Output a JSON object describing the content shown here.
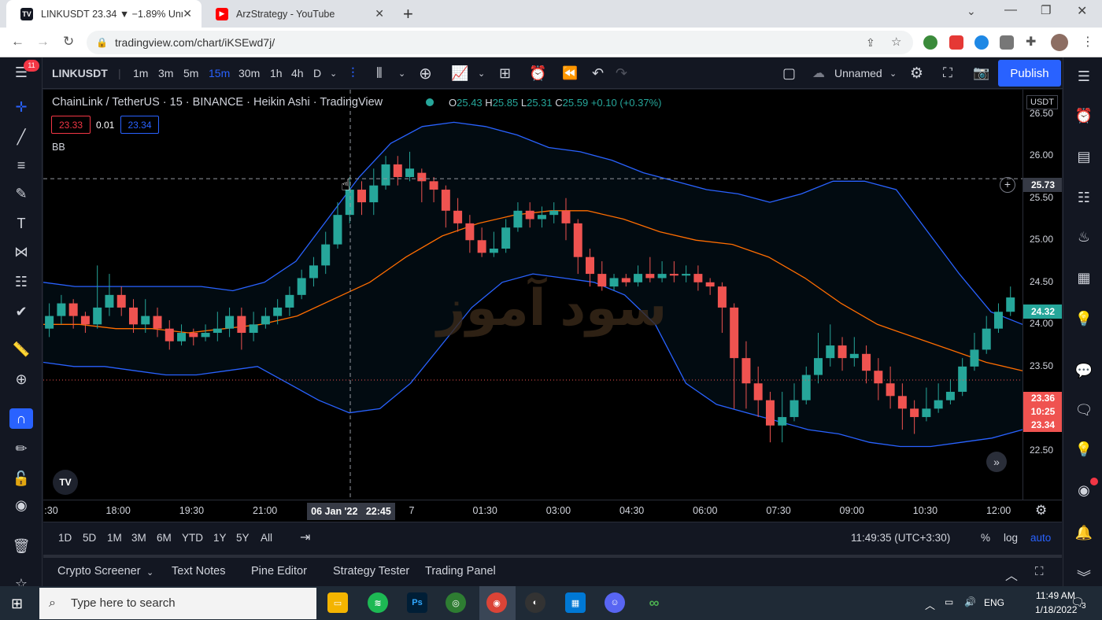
{
  "browser": {
    "tabs": [
      {
        "title": "LINKUSDT 23.34 ▼ −1.89% Unna",
        "icon": "tradingview-icon"
      },
      {
        "title": "ArzStrategy - YouTube",
        "icon": "youtube-icon"
      }
    ],
    "url": "tradingview.com/chart/iKSEwd7j/",
    "new_tab": "+"
  },
  "toolbar": {
    "symbol": "LINKUSDT",
    "intervals": [
      "1m",
      "3m",
      "5m",
      "15m",
      "30m",
      "1h",
      "4h",
      "D"
    ],
    "active_interval": "15m",
    "layout_name": "Unnamed",
    "publish": "Publish",
    "notification_count": "11"
  },
  "legend": {
    "title": "ChainLink / TetherUS · 15 · BINANCE · Heikin Ashi · TradingView",
    "o_label": "O",
    "o": "25.43",
    "h_label": "H",
    "h": "25.85",
    "l_label": "L",
    "l": "25.31",
    "c_label": "C",
    "c": "25.59",
    "change": "+0.10 (+0.37%)",
    "sell_price": "23.33",
    "spread": "0.01",
    "buy_price": "23.34",
    "indicator": "BB"
  },
  "watermark": "سود آموز",
  "price_axis": {
    "currency": "USDT",
    "ticks": [
      "26.50",
      "26.00",
      "25.50",
      "25.00",
      "24.50",
      "24.00",
      "23.50",
      "23.00",
      "22.50"
    ],
    "crosshair_price": "25.73",
    "bb_label": "24.32",
    "last_price_top": "23.36",
    "countdown": "10:25",
    "last_price": "23.34"
  },
  "time_axis": {
    "labels": [
      ":30",
      "18:00",
      "19:30",
      "21:00",
      "7",
      "01:30",
      "03:00",
      "04:30",
      "06:00",
      "07:30",
      "09:00",
      "10:30",
      "12:00"
    ],
    "crosshair_time": "06 Jan '22   22:45"
  },
  "range_bar": {
    "ranges": [
      "1D",
      "5D",
      "1M",
      "3M",
      "6M",
      "YTD",
      "1Y",
      "5Y",
      "All"
    ],
    "clock": "11:49:35 (UTC+3:30)",
    "percent": "%",
    "log": "log",
    "auto": "auto"
  },
  "bottom_tabs": [
    "Crypto Screener",
    "Text Notes",
    "Pine Editor",
    "Strategy Tester",
    "Trading Panel"
  ],
  "taskbar": {
    "search_placeholder": "Type here to search",
    "lang": "ENG",
    "time": "11:49 AM",
    "date": "1/18/2022",
    "notif": "3"
  },
  "colors": {
    "up": "#26a69a",
    "down": "#ef5350",
    "bb_band": "#2962ff",
    "bb_basis": "#ff6d00",
    "accent": "#2962ff"
  },
  "chart_data": {
    "type": "candlestick",
    "symbol": "LINKUSDT",
    "style": "Heikin Ashi",
    "interval": "15",
    "ylim": [
      22.2,
      26.6
    ],
    "candles": [
      {
        "o": 23.95,
        "c": 24.1,
        "h": 24.25,
        "l": 23.85
      },
      {
        "o": 24.1,
        "c": 24.25,
        "h": 24.35,
        "l": 24.0
      },
      {
        "o": 24.25,
        "c": 24.1,
        "h": 24.3,
        "l": 23.95
      },
      {
        "o": 24.1,
        "c": 24.0,
        "h": 24.15,
        "l": 23.9
      },
      {
        "o": 24.0,
        "c": 24.2,
        "h": 24.7,
        "l": 23.95
      },
      {
        "o": 24.2,
        "c": 24.35,
        "h": 24.6,
        "l": 24.1
      },
      {
        "o": 24.35,
        "c": 24.2,
        "h": 24.45,
        "l": 24.1
      },
      {
        "o": 24.2,
        "c": 24.0,
        "h": 24.3,
        "l": 23.9
      },
      {
        "o": 24.0,
        "c": 24.1,
        "h": 24.3,
        "l": 23.9
      },
      {
        "o": 24.1,
        "c": 23.95,
        "h": 24.2,
        "l": 23.85
      },
      {
        "o": 23.95,
        "c": 23.8,
        "h": 24.05,
        "l": 23.7
      },
      {
        "o": 23.8,
        "c": 23.9,
        "h": 24.0,
        "l": 23.75
      },
      {
        "o": 23.9,
        "c": 23.85,
        "h": 23.95,
        "l": 23.75
      },
      {
        "o": 23.85,
        "c": 23.9,
        "h": 24.0,
        "l": 23.8
      },
      {
        "o": 23.9,
        "c": 23.95,
        "h": 24.15,
        "l": 23.8
      },
      {
        "o": 23.95,
        "c": 24.1,
        "h": 24.2,
        "l": 23.85
      },
      {
        "o": 24.1,
        "c": 23.9,
        "h": 24.2,
        "l": 23.7
      },
      {
        "o": 23.9,
        "c": 24.0,
        "h": 24.15,
        "l": 23.8
      },
      {
        "o": 24.0,
        "c": 24.1,
        "h": 24.2,
        "l": 23.95
      },
      {
        "o": 24.1,
        "c": 24.2,
        "h": 24.3,
        "l": 24.0
      },
      {
        "o": 24.2,
        "c": 24.35,
        "h": 24.45,
        "l": 24.1
      },
      {
        "o": 24.35,
        "c": 24.55,
        "h": 24.65,
        "l": 24.3
      },
      {
        "o": 24.55,
        "c": 24.7,
        "h": 24.8,
        "l": 24.45
      },
      {
        "o": 24.7,
        "c": 24.95,
        "h": 25.1,
        "l": 24.6
      },
      {
        "o": 24.95,
        "c": 25.3,
        "h": 25.45,
        "l": 24.9
      },
      {
        "o": 25.3,
        "c": 25.6,
        "h": 25.75,
        "l": 25.2
      },
      {
        "o": 25.6,
        "c": 25.45,
        "h": 25.7,
        "l": 25.3
      },
      {
        "o": 25.45,
        "c": 25.65,
        "h": 25.85,
        "l": 25.3
      },
      {
        "o": 25.65,
        "c": 25.9,
        "h": 26.0,
        "l": 25.6
      },
      {
        "o": 25.9,
        "c": 25.75,
        "h": 26.0,
        "l": 25.65
      },
      {
        "o": 25.75,
        "c": 25.85,
        "h": 26.05,
        "l": 25.7
      },
      {
        "o": 25.8,
        "c": 25.7,
        "h": 25.85,
        "l": 25.45
      },
      {
        "o": 25.7,
        "c": 25.6,
        "h": 25.75,
        "l": 25.45
      },
      {
        "o": 25.6,
        "c": 25.35,
        "h": 25.65,
        "l": 25.15
      },
      {
        "o": 25.35,
        "c": 25.2,
        "h": 25.5,
        "l": 25.1
      },
      {
        "o": 25.2,
        "c": 25.0,
        "h": 25.3,
        "l": 24.85
      },
      {
        "o": 25.0,
        "c": 24.85,
        "h": 25.15,
        "l": 24.8
      },
      {
        "o": 24.85,
        "c": 24.9,
        "h": 25.1,
        "l": 24.8
      },
      {
        "o": 24.9,
        "c": 25.15,
        "h": 25.25,
        "l": 24.85
      },
      {
        "o": 25.15,
        "c": 25.35,
        "h": 25.45,
        "l": 25.1
      },
      {
        "o": 25.35,
        "c": 25.25,
        "h": 25.45,
        "l": 25.15
      },
      {
        "o": 25.25,
        "c": 25.3,
        "h": 25.4,
        "l": 25.15
      },
      {
        "o": 25.3,
        "c": 25.35,
        "h": 25.45,
        "l": 25.2
      },
      {
        "o": 25.35,
        "c": 25.2,
        "h": 25.5,
        "l": 25.0
      },
      {
        "o": 25.2,
        "c": 24.8,
        "h": 25.25,
        "l": 24.6
      },
      {
        "o": 24.8,
        "c": 24.6,
        "h": 24.9,
        "l": 24.45
      },
      {
        "o": 24.6,
        "c": 24.45,
        "h": 24.75,
        "l": 24.4
      },
      {
        "o": 24.45,
        "c": 24.55,
        "h": 24.6,
        "l": 24.4
      },
      {
        "o": 24.55,
        "c": 24.5,
        "h": 24.6,
        "l": 24.45
      },
      {
        "o": 24.5,
        "c": 24.6,
        "h": 24.7,
        "l": 24.45
      },
      {
        "o": 24.6,
        "c": 24.55,
        "h": 24.8,
        "l": 24.5
      },
      {
        "o": 24.55,
        "c": 24.6,
        "h": 24.75,
        "l": 24.5
      },
      {
        "o": 24.6,
        "c": 24.58,
        "h": 24.75,
        "l": 24.5
      },
      {
        "o": 24.58,
        "c": 24.6,
        "h": 24.7,
        "l": 24.5
      },
      {
        "o": 24.6,
        "c": 24.5,
        "h": 24.7,
        "l": 24.4
      },
      {
        "o": 24.5,
        "c": 24.45,
        "h": 24.55,
        "l": 24.35
      },
      {
        "o": 24.45,
        "c": 24.2,
        "h": 24.5,
        "l": 23.9
      },
      {
        "o": 24.2,
        "c": 23.6,
        "h": 24.25,
        "l": 23.0
      },
      {
        "o": 23.6,
        "c": 23.3,
        "h": 23.8,
        "l": 23.0
      },
      {
        "o": 23.3,
        "c": 23.1,
        "h": 23.5,
        "l": 22.9
      },
      {
        "o": 23.1,
        "c": 22.8,
        "h": 23.2,
        "l": 22.6
      },
      {
        "o": 22.8,
        "c": 22.9,
        "h": 23.2,
        "l": 22.6
      },
      {
        "o": 22.9,
        "c": 23.1,
        "h": 23.3,
        "l": 22.85
      },
      {
        "o": 23.1,
        "c": 23.4,
        "h": 23.5,
        "l": 23.05
      },
      {
        "o": 23.4,
        "c": 23.6,
        "h": 23.9,
        "l": 23.3
      },
      {
        "o": 23.6,
        "c": 23.75,
        "h": 24.0,
        "l": 23.5
      },
      {
        "o": 23.75,
        "c": 23.6,
        "h": 23.85,
        "l": 23.45
      },
      {
        "o": 23.6,
        "c": 23.65,
        "h": 23.85,
        "l": 23.5
      },
      {
        "o": 23.65,
        "c": 23.45,
        "h": 23.75,
        "l": 23.3
      },
      {
        "o": 23.45,
        "c": 23.3,
        "h": 23.6,
        "l": 23.1
      },
      {
        "o": 23.3,
        "c": 23.15,
        "h": 23.5,
        "l": 23.0
      },
      {
        "o": 23.15,
        "c": 23.0,
        "h": 23.3,
        "l": 22.75
      },
      {
        "o": 23.0,
        "c": 22.9,
        "h": 23.1,
        "l": 22.7
      },
      {
        "o": 22.9,
        "c": 23.0,
        "h": 23.25,
        "l": 22.85
      },
      {
        "o": 23.0,
        "c": 23.1,
        "h": 23.3,
        "l": 22.95
      },
      {
        "o": 23.1,
        "c": 23.2,
        "h": 23.35,
        "l": 23.05
      },
      {
        "o": 23.2,
        "c": 23.5,
        "h": 23.6,
        "l": 23.15
      },
      {
        "o": 23.5,
        "c": 23.7,
        "h": 23.9,
        "l": 23.45
      },
      {
        "o": 23.7,
        "c": 23.95,
        "h": 24.1,
        "l": 23.65
      },
      {
        "o": 23.95,
        "c": 24.15,
        "h": 24.25,
        "l": 23.9
      },
      {
        "o": 24.15,
        "c": 24.32,
        "h": 24.45,
        "l": 24.1
      }
    ],
    "bb_upper": [
      24.5,
      24.45,
      24.45,
      24.45,
      24.45,
      24.45,
      24.4,
      24.5,
      24.75,
      25.25,
      25.75,
      26.15,
      26.35,
      26.4,
      26.35,
      26.25,
      26.1,
      26.05,
      25.95,
      25.8,
      25.7,
      25.6,
      25.55,
      25.45,
      25.55,
      25.7,
      25.7,
      25.6,
      25.1,
      24.6,
      24.15,
      24.0
    ],
    "bb_basis": [
      24.0,
      24.0,
      23.95,
      23.95,
      23.9,
      23.95,
      24.0,
      24.1,
      24.3,
      24.5,
      24.8,
      25.05,
      25.2,
      25.3,
      25.35,
      25.35,
      25.25,
      25.1,
      25.0,
      24.95,
      24.8,
      24.55,
      24.25,
      24.0,
      23.85,
      23.7,
      23.55,
      23.45
    ],
    "bb_lower": [
      23.55,
      23.5,
      23.5,
      23.45,
      23.4,
      23.4,
      23.45,
      23.5,
      23.3,
      23.1,
      22.95,
      23.0,
      23.3,
      23.75,
      24.2,
      24.5,
      24.6,
      24.55,
      24.5,
      24.35,
      24.0,
      23.3,
      23.05,
      22.95,
      22.85,
      22.75,
      22.7,
      22.6,
      22.55,
      22.55,
      22.6,
      22.65,
      22.75
    ]
  }
}
